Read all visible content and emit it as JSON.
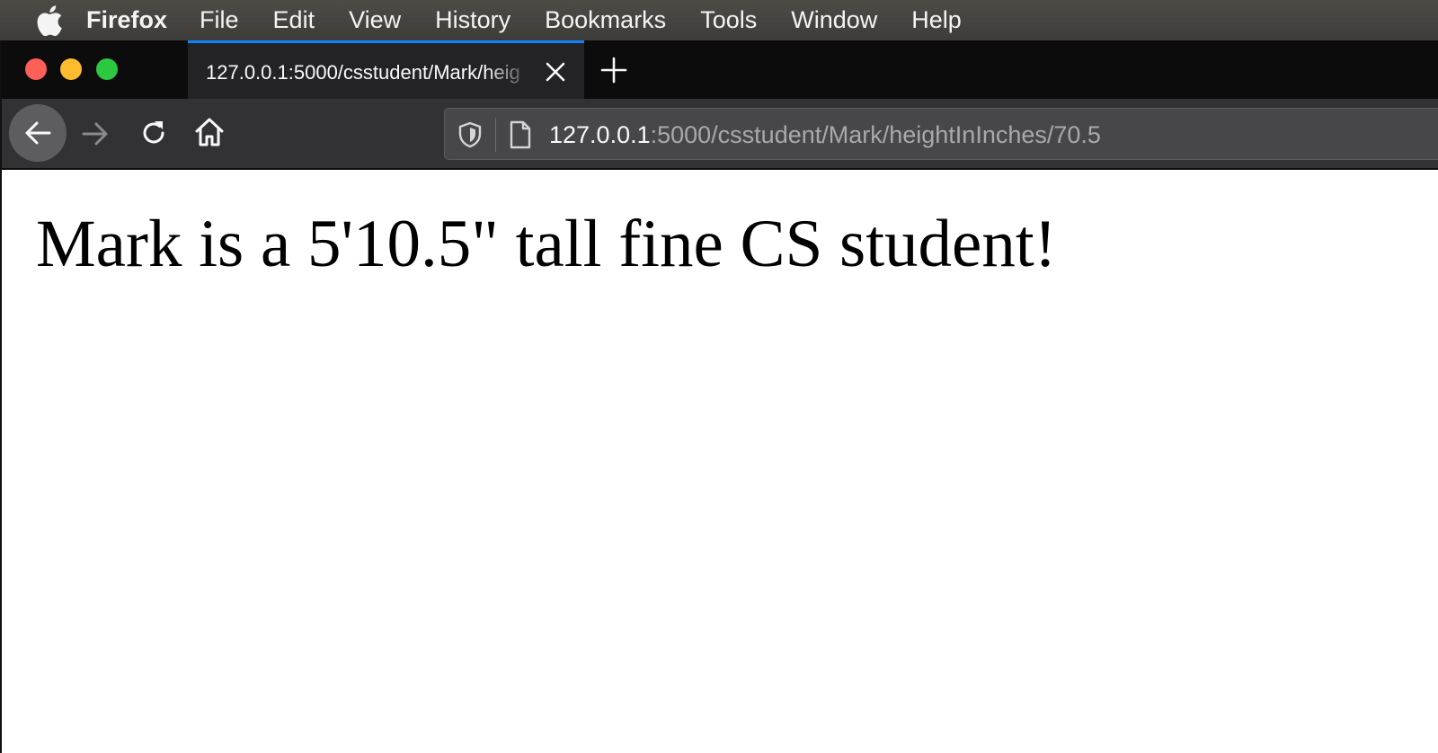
{
  "menubar": {
    "apple_icon": "apple-logo-icon",
    "app_name": "Firefox",
    "items": [
      "File",
      "Edit",
      "View",
      "History",
      "Bookmarks",
      "Tools",
      "Window",
      "Help"
    ]
  },
  "window": {
    "traffic_lights": {
      "close": "#fe5f57",
      "minimize": "#febc2e",
      "zoom": "#2bc840"
    },
    "tab": {
      "title": "127.0.0.1:5000/csstudent/Mark/heig",
      "close_icon": "close-icon",
      "accent": "#0a84ff"
    },
    "new_tab_icon": "plus-icon"
  },
  "navbar": {
    "back_icon": "arrow-left-icon",
    "forward_icon": "arrow-right-icon",
    "reload_icon": "reload-icon",
    "home_icon": "home-icon",
    "url": {
      "host": "127.0.0.1",
      "rest": ":5000/csstudent/Mark/heightInInches/70.5",
      "shield_icon": "shield-icon",
      "page_icon": "page-icon"
    }
  },
  "page": {
    "heading": "Mark is a 5'10.5\" tall fine CS student!"
  }
}
